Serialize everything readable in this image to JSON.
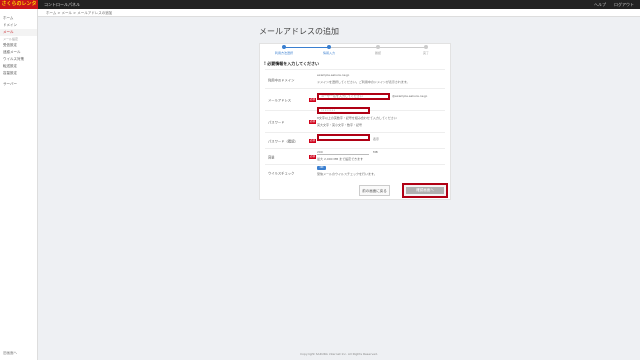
{
  "topbar": {
    "logo": "さくらのレンタルサーバ",
    "site": "コントロールパネル",
    "right": [
      "ヘルプ",
      "ログアウト"
    ]
  },
  "breadcrumb": "ホーム > メール > メールアドレスの追加",
  "sidebar": {
    "items": [
      "ホーム",
      "ドメイン",
      "メール"
    ],
    "section": "メール設定",
    "sub": [
      "受信設定",
      "迷惑メール",
      "ウイルス対策",
      "転送設定",
      "容量設定"
    ],
    "extra": "サーバー",
    "bottom": "旧画面へ"
  },
  "page_title": "メールアドレスの追加",
  "steps": [
    {
      "label": "利用方法選択",
      "active": true
    },
    {
      "label": "情報入力",
      "active": true
    },
    {
      "label": "確認",
      "active": false
    },
    {
      "label": "完了",
      "active": false
    }
  ],
  "notice": "必要情報を入力してください",
  "form": {
    "domain_label": "利用中のドメイン",
    "domain_value": "example.sakura.ne.jp",
    "domain_note": "ドメインを選択してください。ご利用中のドメインが表示されます。",
    "address_label": "メールアドレス",
    "required_badge": "必須",
    "address_placeholder": "ユーザー名を入力してください",
    "address_suffix": "@example.sakura.ne.jp",
    "password_label": "パスワード",
    "password_value": "••••••••",
    "password_note1": "8文字以上の英数字・記号を組み合わせて入力してください",
    "password_note2": "英大文字・英小文字・数字・記号",
    "password_confirm_label": "パスワード（確認）",
    "password_confirm_suffix": "表示",
    "quota_label": "容量",
    "quota_value": "200",
    "quota_unit": "MB",
    "quota_note": "最大 2,000 MB まで設定できます",
    "virus_label": "ウイルスチェック",
    "virus_toggle": "ON",
    "virus_note": "受信メールのウイルスチェックを行います。"
  },
  "buttons": {
    "prev": "前の画面に戻る",
    "next": "確認画面へ"
  },
  "footer": "Copyright SAKURA internet Inc. All Rights Reserved."
}
